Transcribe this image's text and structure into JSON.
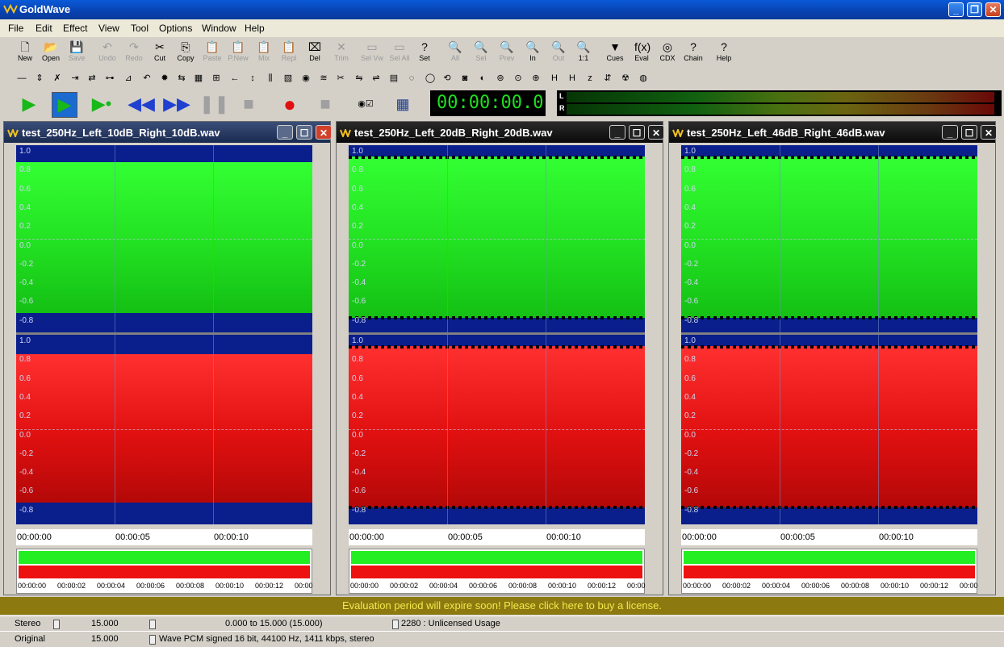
{
  "app": {
    "title": "GoldWave"
  },
  "menu": [
    "File",
    "Edit",
    "Effect",
    "View",
    "Tool",
    "Options",
    "Window",
    "Help"
  ],
  "toolbar": [
    {
      "label": "New",
      "icon": "new-icon",
      "enabled": true
    },
    {
      "label": "Open",
      "icon": "open-icon",
      "enabled": true
    },
    {
      "label": "Save",
      "icon": "save-icon",
      "enabled": false
    },
    {
      "label": "Undo",
      "icon": "undo-icon",
      "enabled": false
    },
    {
      "label": "Redo",
      "icon": "redo-icon",
      "enabled": false
    },
    {
      "label": "Cut",
      "icon": "cut-icon",
      "enabled": true
    },
    {
      "label": "Copy",
      "icon": "copy-icon",
      "enabled": true
    },
    {
      "label": "Paste",
      "icon": "paste-icon",
      "enabled": false
    },
    {
      "label": "P.New",
      "icon": "paste-new-icon",
      "enabled": false
    },
    {
      "label": "Mix",
      "icon": "mix-icon",
      "enabled": false
    },
    {
      "label": "Repl",
      "icon": "replace-icon",
      "enabled": false
    },
    {
      "label": "Del",
      "icon": "delete-icon",
      "enabled": true
    },
    {
      "label": "Trim",
      "icon": "trim-icon",
      "enabled": false
    },
    {
      "label": "Sel Vw",
      "icon": "select-view-icon",
      "enabled": false
    },
    {
      "label": "Sel All",
      "icon": "select-all-icon",
      "enabled": false
    },
    {
      "label": "Set",
      "icon": "set-icon",
      "enabled": true
    },
    {
      "label": "All",
      "icon": "zoom-all-icon",
      "enabled": false
    },
    {
      "label": "Sel",
      "icon": "zoom-sel-icon",
      "enabled": false
    },
    {
      "label": "Prev",
      "icon": "zoom-prev-icon",
      "enabled": false
    },
    {
      "label": "In",
      "icon": "zoom-in-icon",
      "enabled": true
    },
    {
      "label": "Out",
      "icon": "zoom-out-icon",
      "enabled": false
    },
    {
      "label": "1:1",
      "icon": "zoom-1-1-icon",
      "enabled": true
    },
    {
      "label": "Cues",
      "icon": "cues-icon",
      "enabled": true
    },
    {
      "label": "Eval",
      "icon": "eval-icon",
      "enabled": true
    },
    {
      "label": "CDX",
      "icon": "cdx-icon",
      "enabled": true
    },
    {
      "label": "Chain",
      "icon": "chain-icon",
      "enabled": true
    },
    {
      "label": "Help",
      "icon": "help-icon",
      "enabled": true
    }
  ],
  "transport": {
    "time": "00:00:00.0",
    "meter_labels": [
      "L",
      "R"
    ]
  },
  "documents": [
    {
      "name": "test_250Hz_Left_10dB_Right_10dB.wav",
      "active": true
    },
    {
      "name": "test_250Hz_Left_20dB_Right_20dB.wav",
      "active": false
    },
    {
      "name": "test_250Hz_Left_46dB_Right_46dB.wav",
      "active": false
    }
  ],
  "y_labels": [
    "1.0",
    "0.8",
    "0.6",
    "0.4",
    "0.2",
    "0.0",
    "-0.2",
    "-0.4",
    "-0.6",
    "-0.8"
  ],
  "y_labels_right": [
    "1.0",
    "0.8",
    "0.6",
    "0.4",
    "0.2",
    "0.0",
    "-0.2",
    "-0.4",
    "-0.6",
    "-0.8"
  ],
  "timeline_labels": [
    "00:00:00",
    "00:00:05",
    "00:00:10"
  ],
  "overview_labels": [
    "00:00:00",
    "00:00:02",
    "00:00:04",
    "00:00:06",
    "00:00:08",
    "00:00:10",
    "00:00:12",
    "00:00"
  ],
  "eval_message": "Evaluation period will expire soon! Please click here to buy a license.",
  "status": {
    "row1": {
      "channels": "Stereo",
      "length": "15.000",
      "selection": "0.000 to 15.000 (15.000)",
      "usage": "2280 : Unlicensed Usage"
    },
    "row2": {
      "label": "Original",
      "length": "15.000",
      "format": "Wave PCM signed 16 bit, 44100 Hz, 1411 kbps, stereo"
    }
  },
  "colors": {
    "left_channel": "#22ee22",
    "right_channel": "#ee1111",
    "wave_bg": "#0a1e8c",
    "title_active": "#0a4fd0"
  }
}
